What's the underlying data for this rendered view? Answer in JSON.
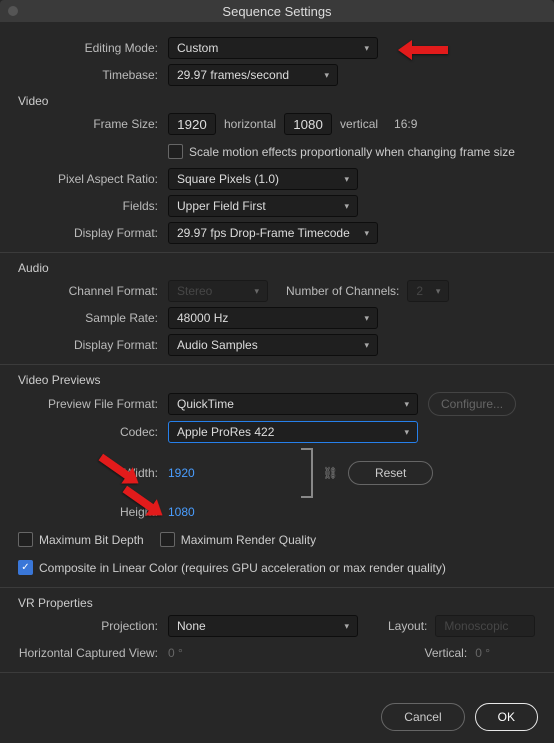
{
  "title": "Sequence Settings",
  "editingMode": {
    "label": "Editing Mode:",
    "value": "Custom"
  },
  "timebase": {
    "label": "Timebase:",
    "value": "29.97  frames/second"
  },
  "sections": {
    "video": "Video",
    "audio": "Audio",
    "previews": "Video Previews",
    "vr": "VR Properties"
  },
  "frameSize": {
    "label": "Frame Size:",
    "w": "1920",
    "h": "1080",
    "horizontal": "horizontal",
    "vertical": "vertical",
    "aspect": "16:9"
  },
  "scaleMotion": {
    "label": "Scale motion effects proportionally when changing frame size"
  },
  "pixelAspect": {
    "label": "Pixel Aspect Ratio:",
    "value": "Square Pixels (1.0)"
  },
  "fields": {
    "label": "Fields:",
    "value": "Upper Field First"
  },
  "videoDisplayFormat": {
    "label": "Display Format:",
    "value": "29.97 fps Drop-Frame Timecode"
  },
  "channelFormat": {
    "label": "Channel Format:",
    "value": "Stereo"
  },
  "numChannels": {
    "label": "Number of Channels:",
    "value": "2"
  },
  "sampleRate": {
    "label": "Sample Rate:",
    "value": "48000 Hz"
  },
  "audioDisplayFormat": {
    "label": "Display Format:",
    "value": "Audio Samples"
  },
  "previewFileFormat": {
    "label": "Preview File Format:",
    "value": "QuickTime",
    "configure": "Configure..."
  },
  "codec": {
    "label": "Codec:",
    "value": "Apple ProRes 422"
  },
  "width": {
    "label": "Width:",
    "value": "1920"
  },
  "height": {
    "label": "Height:",
    "value": "1080"
  },
  "linkIcon": "⛓",
  "reset": "Reset",
  "maxBitDepth": "Maximum Bit Depth",
  "maxRenderQuality": "Maximum Render Quality",
  "composite": "Composite in Linear Color (requires GPU acceleration or max render quality)",
  "projection": {
    "label": "Projection:",
    "value": "None"
  },
  "layout": {
    "label": "Layout:",
    "value": "Monoscopic"
  },
  "hcv": {
    "label": "Horizontal Captured View:",
    "value": "0 °"
  },
  "vcv": {
    "label": "Vertical:",
    "value": "0 °"
  },
  "cancel": "Cancel",
  "ok": "OK"
}
